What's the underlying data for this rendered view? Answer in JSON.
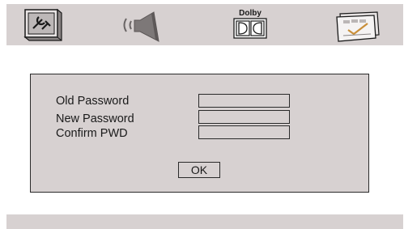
{
  "menu": {
    "icons": [
      "system-setup-icon",
      "audio-speaker-icon",
      "dolby-icon",
      "preference-icon"
    ],
    "dolby_label": "Dolby"
  },
  "password_dialog": {
    "old_password_label": "Old Password",
    "new_password_label": "New Password",
    "confirm_label": "Confirm PWD",
    "old_password_value": "",
    "new_password_value": "",
    "confirm_value": "",
    "ok_label": "OK"
  },
  "colors": {
    "panel_background": "#d7d1d1",
    "border": "#2a2a2a",
    "text": "#1a1a1a"
  }
}
